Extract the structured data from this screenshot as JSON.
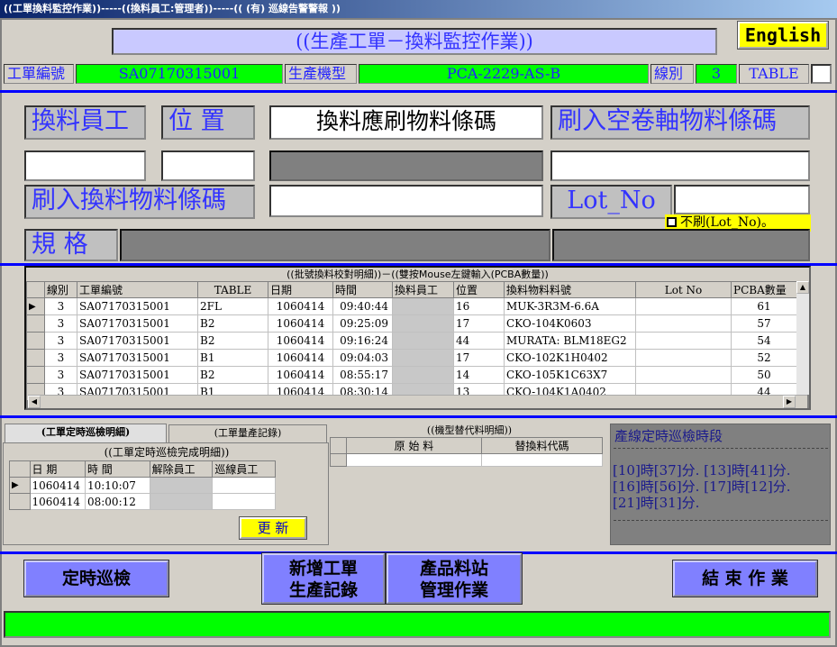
{
  "window": {
    "title": "((工單換料監控作業))-----((換料員工:管理者))-----(( (有) 巡線告警警報 ))"
  },
  "header": {
    "title": "((生產工單－換料監控作業))",
    "english_label": "English"
  },
  "info_row": {
    "work_order_label": "工單編號",
    "work_order_value": "SA07170315001",
    "machine_label": "生產機型",
    "machine_value": "PCA-2229-AS-B",
    "line_label": "線別",
    "line_value": "3",
    "table_label": "TABLE",
    "table_value": ""
  },
  "form": {
    "operator_label": "換料員工",
    "position_label": "位 置",
    "required_barcode_label": "換料應刷物料條碼",
    "empty_reel_label": "刷入空卷軸物料條碼",
    "scan_material_label": "刷入換料物料條碼",
    "lot_no_label": "Lot_No",
    "no_scan_label": "不刷(Lot_No)。",
    "spec_label": "規 格"
  },
  "batch_grid": {
    "caption": "((批號換料校對明細))－((雙按Mouse左鍵輸入(PCBA數量))",
    "columns": [
      "線別",
      "工單編號",
      "TABLE",
      "日期",
      "時間",
      "換料員工",
      "位置",
      "換料物料料號",
      "Lot No",
      "PCBA數量"
    ],
    "rows": [
      {
        "line": "3",
        "order": "SA07170315001",
        "table": "2FL",
        "date": "1060414",
        "time": "09:40:44",
        "operator": "",
        "pos": "16",
        "part": "MUK-3R3M-6.6A",
        "lot": "",
        "qty": "61"
      },
      {
        "line": "3",
        "order": "SA07170315001",
        "table": "B2",
        "date": "1060414",
        "time": "09:25:09",
        "operator": "",
        "pos": "17",
        "part": "CKO-104K0603",
        "lot": "",
        "qty": "57"
      },
      {
        "line": "3",
        "order": "SA07170315001",
        "table": "B2",
        "date": "1060414",
        "time": "09:16:24",
        "operator": "",
        "pos": "44",
        "part": "MURATA: BLM18EG2",
        "lot": "",
        "qty": "54"
      },
      {
        "line": "3",
        "order": "SA07170315001",
        "table": "B1",
        "date": "1060414",
        "time": "09:04:03",
        "operator": "",
        "pos": "17",
        "part": "CKO-102K1H0402",
        "lot": "",
        "qty": "52"
      },
      {
        "line": "3",
        "order": "SA07170315001",
        "table": "B2",
        "date": "1060414",
        "time": "08:55:17",
        "operator": "",
        "pos": "14",
        "part": "CKO-105K1C63X7",
        "lot": "",
        "qty": "50"
      },
      {
        "line": "3",
        "order": "SA07170315001",
        "table": "B1",
        "date": "1060414",
        "time": "08:30:14",
        "operator": "",
        "pos": "13",
        "part": "CKO-104K1A0402",
        "lot": "",
        "qty": "44"
      }
    ]
  },
  "tabs": {
    "tab1_label": "(工單定時巡檢明細)",
    "tab2_label": "(工單量產記錄)",
    "inner_caption": "((工單定時巡檢完成明細))",
    "columns": [
      "日 期",
      "時 間",
      "解除員工",
      "巡線員工"
    ],
    "rows": [
      {
        "date": "1060414",
        "time": "10:10:07",
        "release": "",
        "patrol": ""
      },
      {
        "date": "1060414",
        "time": "08:00:12",
        "release": "",
        "patrol": ""
      }
    ],
    "update_label": "更 新"
  },
  "alt_material": {
    "caption": "((機型替代料明細))",
    "columns": [
      "原 始 料",
      "替換料代碼"
    ]
  },
  "patrol": {
    "title": "產線定時巡檢時段",
    "lines": [
      "[10]時[37]分.    [13]時[41]分.",
      "[16]時[56]分.    [17]時[12]分.",
      "[21]時[31]分."
    ]
  },
  "buttons": {
    "timed_patrol": "定時巡檢",
    "new_order_line1": "新增工單",
    "new_order_line2": "生產記錄",
    "product_station_line1": "產品料站",
    "product_station_line2": "管理作業",
    "end_job": "結 束 作 業"
  },
  "colors": {
    "green": "#00ff00",
    "yellow": "#ffff00",
    "blue_button": "#8080ff",
    "separator": "#0000ff"
  }
}
